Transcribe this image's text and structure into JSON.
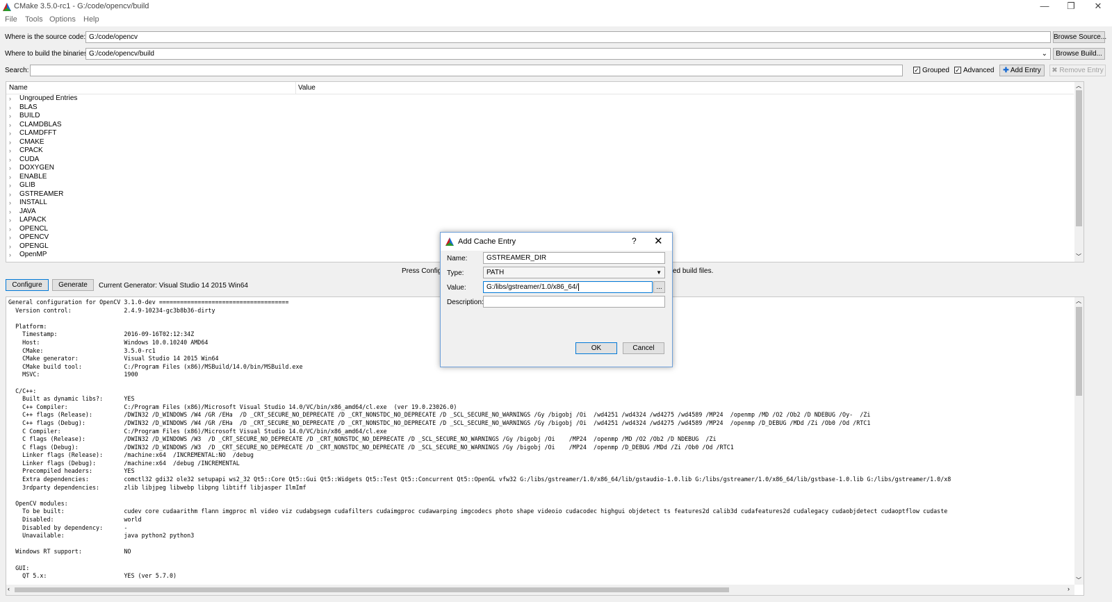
{
  "window": {
    "title": "CMake 3.5.0-rc1 - G:/code/opencv/build",
    "minimize": "—",
    "restore": "❐",
    "close": "✕"
  },
  "menu": [
    "File",
    "Tools",
    "Options",
    "Help"
  ],
  "source": {
    "label": "Where is the source code:",
    "value": "G:/code/opencv",
    "button": "Browse Source..."
  },
  "build": {
    "label": "Where to build the binaries:",
    "value": "G:/code/opencv/build",
    "button": "Browse Build..."
  },
  "search": {
    "label": "Search:",
    "value": "",
    "grouped_label": "Grouped",
    "advanced_label": "Advanced",
    "grouped_checked": true,
    "advanced_checked": true,
    "add_entry": "Add Entry",
    "remove_entry": "Remove Entry"
  },
  "tree": {
    "columns": [
      "Name",
      "Value"
    ],
    "items": [
      "Ungrouped Entries",
      "BLAS",
      "BUILD",
      "CLAMDBLAS",
      "CLAMDFFT",
      "CMAKE",
      "CPACK",
      "CUDA",
      "DOXYGEN",
      "ENABLE",
      "GLIB",
      "GSTREAMER",
      "INSTALL",
      "JAVA",
      "LAPACK",
      "OPENCL",
      "OPENCV",
      "OPENGL",
      "OpenMP"
    ]
  },
  "status": {
    "left": "Press Configu",
    "right": "ed build files."
  },
  "actions": {
    "configure": "Configure",
    "generate": "Generate",
    "generator": "Current Generator: Visual Studio 14 2015 Win64"
  },
  "output_lines": [
    "General configuration for OpenCV 3.1.0-dev =====================================",
    "  Version control:               2.4.9-10234-gc3b8b36-dirty",
    "",
    "  Platform:",
    "    Timestamp:                   2016-09-16T02:12:34Z",
    "    Host:                        Windows 10.0.10240 AMD64",
    "    CMake:                       3.5.0-rc1",
    "    CMake generator:             Visual Studio 14 2015 Win64",
    "    CMake build tool:            C:/Program Files (x86)/MSBuild/14.0/bin/MSBuild.exe",
    "    MSVC:                        1900",
    "",
    "  C/C++:",
    "    Built as dynamic libs?:      YES",
    "    C++ Compiler:                C:/Program Files (x86)/Microsoft Visual Studio 14.0/VC/bin/x86_amd64/cl.exe  (ver 19.0.23026.0)",
    "    C++ flags (Release):         /DWIN32 /D_WINDOWS /W4 /GR /EHa  /D _CRT_SECURE_NO_DEPRECATE /D _CRT_NONSTDC_NO_DEPRECATE /D _SCL_SECURE_NO_WARNINGS /Gy /bigobj /Oi  /wd4251 /wd4324 /wd4275 /wd4589 /MP24  /openmp /MD /O2 /Ob2 /D NDEBUG /Oy-  /Zi",
    "    C++ flags (Debug):           /DWIN32 /D_WINDOWS /W4 /GR /EHa  /D _CRT_SECURE_NO_DEPRECATE /D _CRT_NONSTDC_NO_DEPRECATE /D _SCL_SECURE_NO_WARNINGS /Gy /bigobj /Oi  /wd4251 /wd4324 /wd4275 /wd4589 /MP24  /openmp /D_DEBUG /MDd /Zi /Ob0 /Od /RTC1",
    "    C Compiler:                  C:/Program Files (x86)/Microsoft Visual Studio 14.0/VC/bin/x86_amd64/cl.exe",
    "    C flags (Release):           /DWIN32 /D_WINDOWS /W3  /D _CRT_SECURE_NO_DEPRECATE /D _CRT_NONSTDC_NO_DEPRECATE /D _SCL_SECURE_NO_WARNINGS /Gy /bigobj /Oi    /MP24  /openmp /MD /O2 /Ob2 /D NDEBUG  /Zi",
    "    C flags (Debug):             /DWIN32 /D_WINDOWS /W3  /D _CRT_SECURE_NO_DEPRECATE /D _CRT_NONSTDC_NO_DEPRECATE /D _SCL_SECURE_NO_WARNINGS /Gy /bigobj /Oi    /MP24  /openmp /D_DEBUG /MDd /Zi /Ob0 /Od /RTC1",
    "    Linker flags (Release):      /machine:x64  /INCREMENTAL:NO  /debug",
    "    Linker flags (Debug):        /machine:x64  /debug /INCREMENTAL",
    "    Precompiled headers:         YES",
    "    Extra dependencies:          comctl32 gdi32 ole32 setupapi ws2_32 Qt5::Core Qt5::Gui Qt5::Widgets Qt5::Test Qt5::Concurrent Qt5::OpenGL vfw32 G:/libs/gstreamer/1.0/x86_64/lib/gstaudio-1.0.lib G:/libs/gstreamer/1.0/x86_64/lib/gstbase-1.0.lib G:/libs/gstreamer/1.0/x8",
    "    3rdparty dependencies:       zlib libjpeg libwebp libpng libtiff libjasper IlmImf",
    "",
    "  OpenCV modules:",
    "    To be built:                 cudev core cudaarithm flann imgproc ml video viz cudabgsegm cudafilters cudaimgproc cudawarping imgcodecs photo shape videoio cudacodec highgui objdetect ts features2d calib3d cudafeatures2d cudalegacy cudaobjdetect cudaoptflow cudaste",
    "    Disabled:                    world",
    "    Disabled by dependency:      -",
    "    Unavailable:                 java python2 python3",
    "",
    "  Windows RT support:            NO",
    "",
    "  GUI:",
    "    QT 5.x:                      YES (ver 5.7.0)"
  ],
  "dialog": {
    "title": "Add Cache Entry",
    "help": "?",
    "close": "✕",
    "name_label": "Name:",
    "name_value": "GSTREAMER_DIR",
    "type_label": "Type:",
    "type_value": "PATH",
    "value_label": "Value:",
    "value_value": "G:/libs/gstreamer/1.0/x86_64/",
    "browse": "...",
    "description_label": "Description:",
    "description_value": "",
    "ok": "OK",
    "cancel": "Cancel"
  }
}
